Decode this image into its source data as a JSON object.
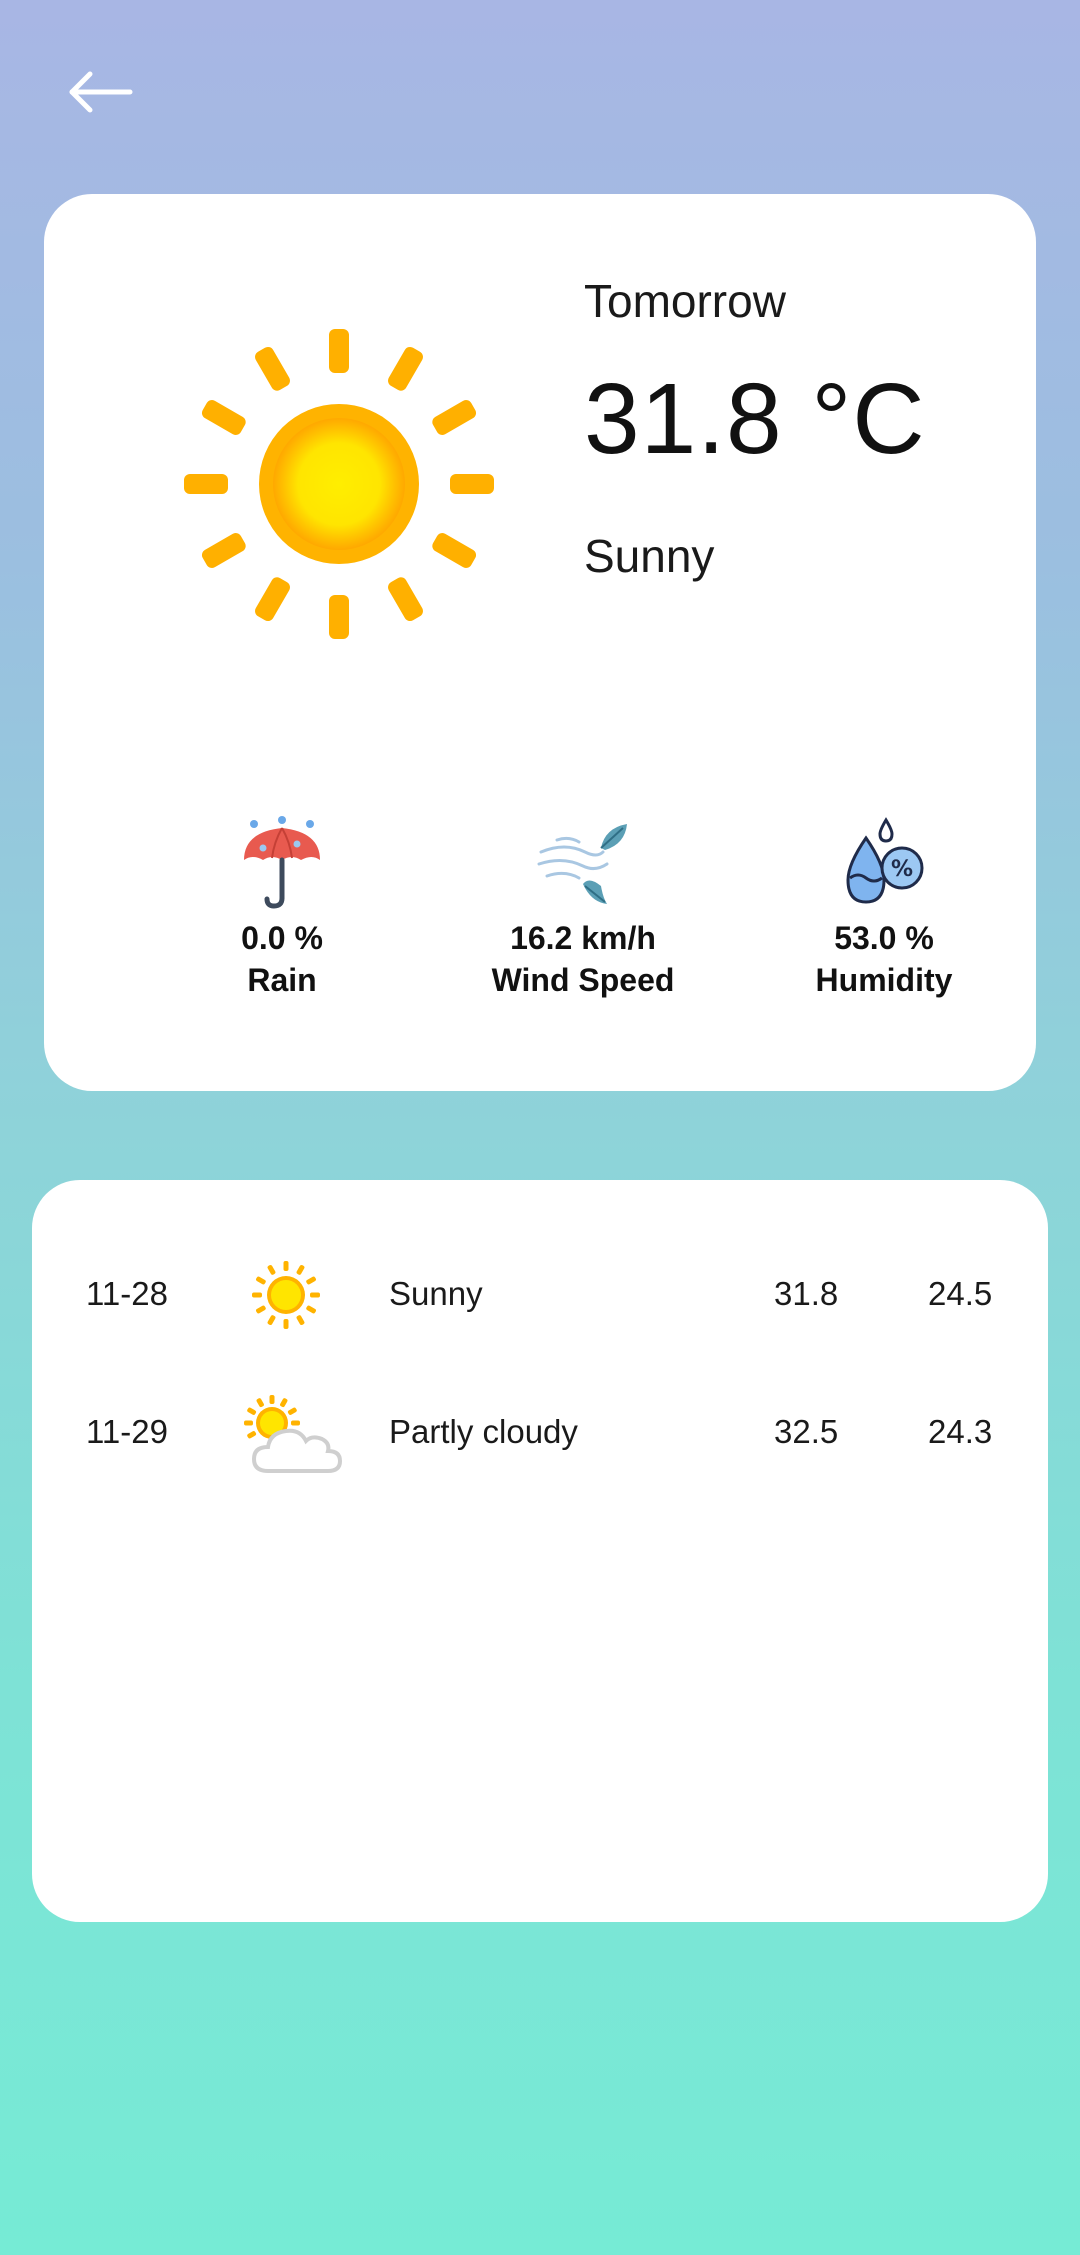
{
  "nav": {
    "back_icon": "arrow-left-icon"
  },
  "today": {
    "day": "Tomorrow",
    "temperature": "31.8 °C",
    "condition": "Sunny",
    "icon": "sun-icon"
  },
  "stats": [
    {
      "icon": "umbrella-icon",
      "value": "0.0 %",
      "label": "Rain"
    },
    {
      "icon": "wind-icon",
      "value": "16.2 km/h",
      "label": "Wind Speed"
    },
    {
      "icon": "humidity-icon",
      "value": "53.0 %",
      "label": "Humidity"
    }
  ],
  "forecast": [
    {
      "date": "11-28",
      "icon": "sun-icon",
      "condition": "Sunny",
      "high": "31.8",
      "low": "24.5"
    },
    {
      "date": "11-29",
      "icon": "partly-cloudy-icon",
      "condition": "Partly cloudy",
      "high": "32.5",
      "low": "24.3"
    }
  ],
  "colors": {
    "sun_core": "#ffe800",
    "sun_ring": "#ffb400",
    "umbrella": "#e85a4f",
    "drop": "#6aa8e8",
    "leaf": "#5b9fb5"
  }
}
